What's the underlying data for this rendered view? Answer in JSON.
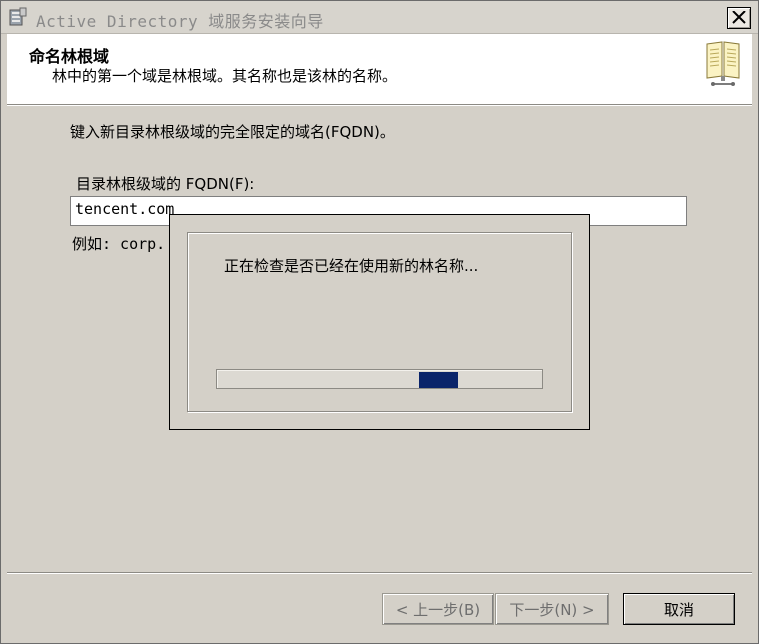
{
  "window": {
    "title": "Active Directory 域服务安装向导"
  },
  "header": {
    "title": "命名林根域",
    "subtitle": "林中的第一个域是林根域。其名称也是该林的名称。"
  },
  "body": {
    "instruction": "键入新目录林根级域的完全限定的域名(FQDN)。",
    "fqdn_label": "目录林根级域的 FQDN(F):",
    "fqdn_value": "tencent.com",
    "example_text": "例如: corp."
  },
  "progress_dialog": {
    "message": "正在检查是否已经在使用新的林名称...",
    "progress_fraction_start": 0.62,
    "progress_fraction_width": 0.12,
    "bar_color": "#0a246a"
  },
  "buttons": {
    "back": "< 上一步(B)",
    "next": "下一步(N) >",
    "cancel": "取消"
  }
}
